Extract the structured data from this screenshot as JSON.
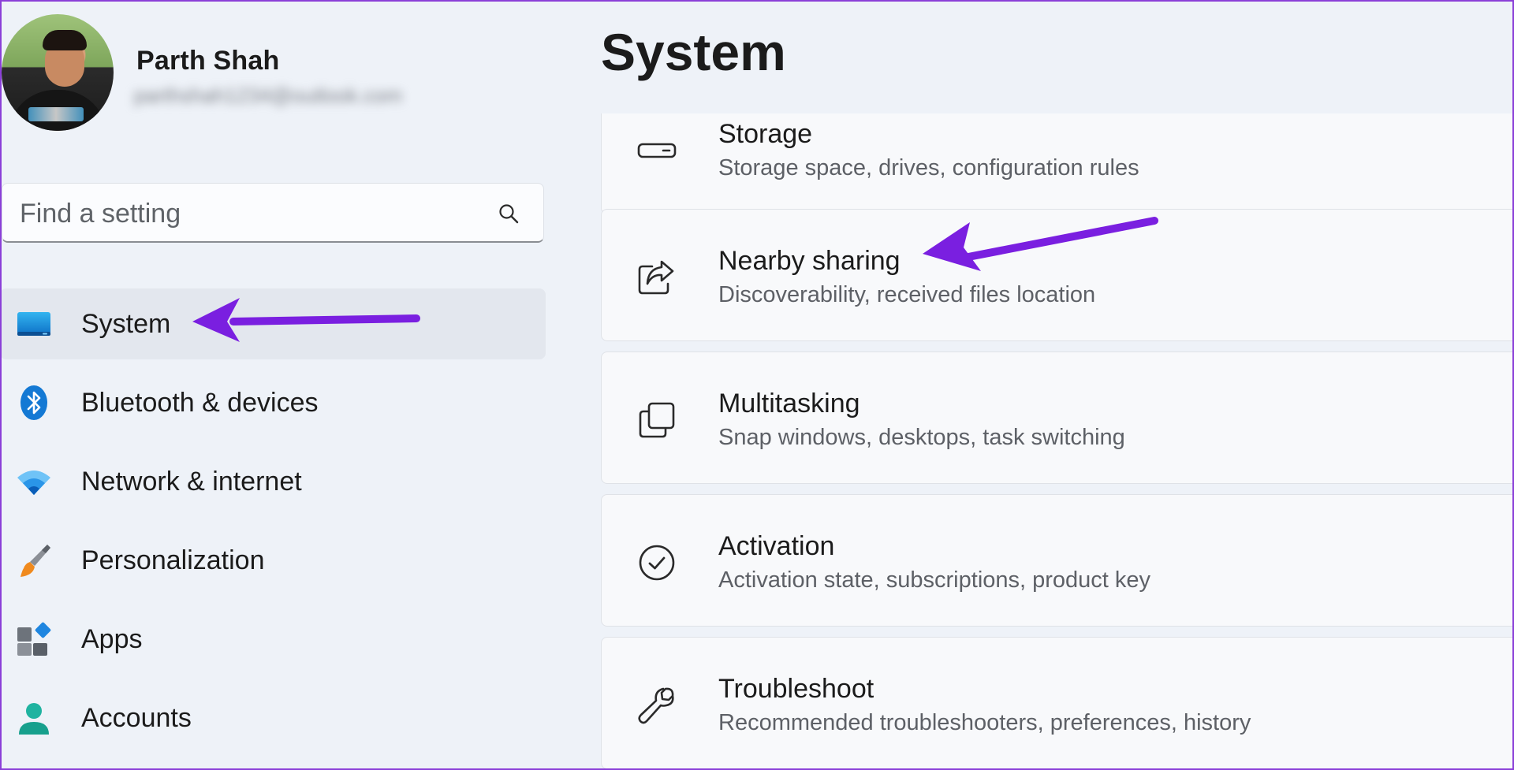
{
  "profile": {
    "name": "Parth Shah",
    "email": "parthshah1234@outlook.com"
  },
  "search": {
    "placeholder": "Find a setting",
    "value": "",
    "icon": "search-icon"
  },
  "nav": {
    "items": [
      {
        "label": "System",
        "icon": "system-display-icon",
        "active": true
      },
      {
        "label": "Bluetooth & devices",
        "icon": "bluetooth-icon"
      },
      {
        "label": "Network & internet",
        "icon": "wifi-icon"
      },
      {
        "label": "Personalization",
        "icon": "paintbrush-icon"
      },
      {
        "label": "Apps",
        "icon": "apps-icon"
      },
      {
        "label": "Accounts",
        "icon": "accounts-icon"
      }
    ]
  },
  "page": {
    "title": "System"
  },
  "settings": {
    "items": [
      {
        "title": "Storage",
        "description": "Storage space, drives, configuration rules",
        "icon": "storage-drive-icon"
      },
      {
        "title": "Nearby sharing",
        "description": "Discoverability, received files location",
        "icon": "share-icon"
      },
      {
        "title": "Multitasking",
        "description": "Snap windows, desktops, task switching",
        "icon": "multitasking-icon"
      },
      {
        "title": "Activation",
        "description": "Activation state, subscriptions, product key",
        "icon": "checkmark-circle-icon"
      },
      {
        "title": "Troubleshoot",
        "description": "Recommended troubleshooters, preferences, history",
        "icon": "wrench-icon"
      }
    ]
  },
  "colors": {
    "annotation_arrow": "#7a1fe0",
    "border_frame": "#8b3fd8",
    "background": "#eef2f8",
    "active_nav": "#e3e7ee"
  }
}
